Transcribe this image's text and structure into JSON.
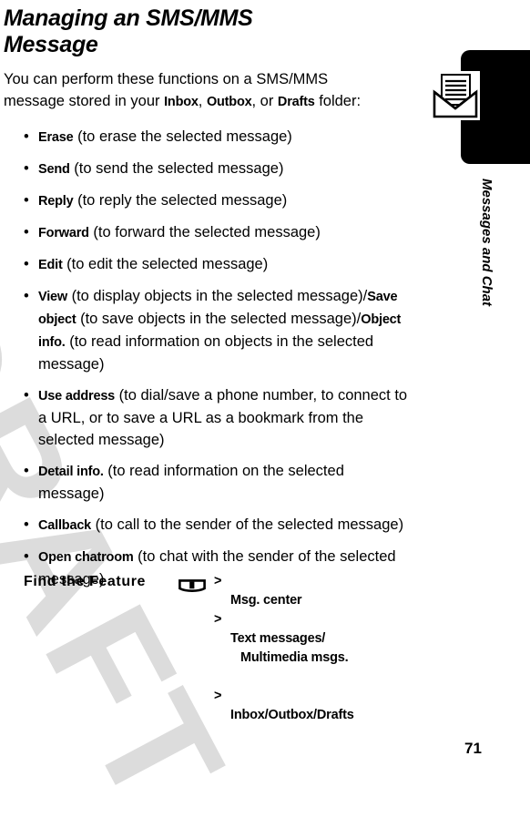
{
  "page": {
    "title": "Managing an SMS/MMS Message",
    "number": "71",
    "watermark": "DRAFT"
  },
  "sidebar": {
    "label": "Messages and Chat",
    "icon": "envelope-icon",
    "tab_color": "#000000"
  },
  "intro": {
    "lead": "You can perform these functions on a SMS/MMS message stored in your ",
    "folder_inbox": "Inbox",
    "sep1": ", ",
    "folder_outbox": "Outbox",
    "sep2": ", or ",
    "folder_drafts": "Drafts",
    "tail": " folder:"
  },
  "functions": [
    {
      "term": "Erase",
      "desc": " (to erase the selected message)"
    },
    {
      "term": "Send",
      "desc": " (to send the selected message)"
    },
    {
      "term": "Reply",
      "desc": " (to reply the selected message)"
    },
    {
      "term": "Forward",
      "desc": " (to forward the selected message)"
    },
    {
      "term": "Edit",
      "desc": " (to edit the selected message)"
    },
    {
      "term": "View",
      "desc": " (to display objects in the selected message)/",
      "term2": "Save object",
      "desc2": " (to save objects in the selected message)/",
      "term3": "Object info.",
      "desc3": " (to read information on objects in the selected message)"
    },
    {
      "term": "Use address",
      "desc": " (to dial/save a phone number, to connect to a URL, or to save a URL as a bookmark from the selected message)"
    },
    {
      "term": "Detail info.",
      "desc": " (to read information on the selected message)"
    },
    {
      "term": "Callback",
      "desc": " (to call to the sender of the selected message)"
    },
    {
      "term": "Open chatroom",
      "desc": " (to chat with the sender of the selected message)"
    }
  ],
  "find_the_feature": {
    "label": "Find the Feature",
    "icon": "menu-key-icon",
    "steps": [
      {
        "marker": ">",
        "text": "Msg. center"
      },
      {
        "marker": ">",
        "text": "Text messages/",
        "cont": "Multimedia msgs."
      },
      {
        "marker": ">",
        "text": "Inbox/Outbox/Drafts"
      }
    ]
  },
  "colors": {
    "text": "#000000",
    "watermark": "#dcdcdc",
    "tab": "#000000",
    "background": "#ffffff"
  }
}
